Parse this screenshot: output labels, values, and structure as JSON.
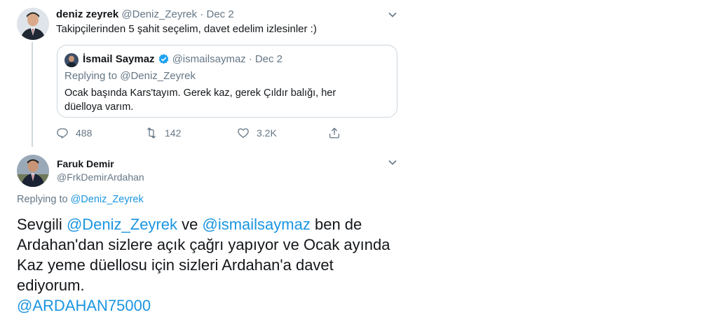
{
  "tweet": {
    "author_name": "deniz zeyrek",
    "author_handle": "@Deniz_Zeyrek",
    "separator": "·",
    "date": "Dec 2",
    "text": "Takipçilerinden 5 şahit seçelim, davet edelim izlesinler :)",
    "quoted": {
      "author_name": "İsmail Saymaz",
      "author_handle": "@ismailsaymaz",
      "date": "Dec 2",
      "replying_to_prefix": "Replying to",
      "replying_to_handle": "@Deniz_Zeyrek",
      "text": "Ocak başında Kars'tayım. Gerek kaz, gerek Çıldır balığı, her düelloya varım."
    },
    "actions": {
      "replies": "488",
      "retweets": "142",
      "likes": "3.2K"
    }
  },
  "reply": {
    "author_name": "Faruk Demir",
    "author_handle": "@FrkDemirArdahan",
    "replying_to_prefix": "Replying to",
    "replying_to_handle": "@Deniz_Zeyrek",
    "body": {
      "prefix": "Sevgili",
      "mention1": "@Deniz_Zeyrek",
      "conj": "ve",
      "mention2": "@ismailsaymaz",
      "rest": "ben de Ardahan'dan sizlere açık çağrı yapıyor ve Ocak ayında Kaz yeme düellosu için sizleri Ardahan'a davet ediyorum.",
      "mention3": "@ARDAHAN75000"
    }
  },
  "colors": {
    "link": "#1b95e0",
    "muted": "#657786",
    "text": "#14171a",
    "verified": "#1da1f2"
  }
}
